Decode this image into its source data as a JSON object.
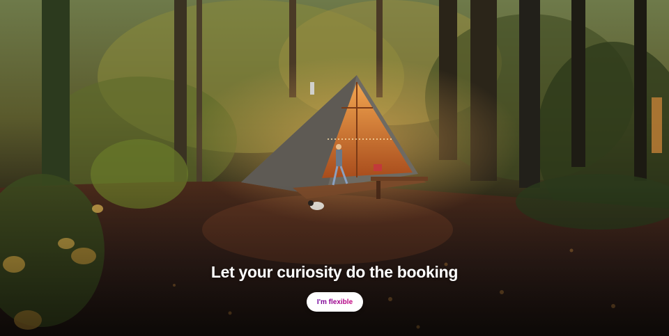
{
  "hero": {
    "headline": "Let your curiosity do the booking",
    "scene": "forest-a-frame-cabin-photo"
  },
  "cta": {
    "label": "I'm flexible"
  },
  "colors": {
    "cta_gradient_start": "#6f019c",
    "cta_gradient_end": "#c6017e",
    "headline": "#ffffff"
  }
}
